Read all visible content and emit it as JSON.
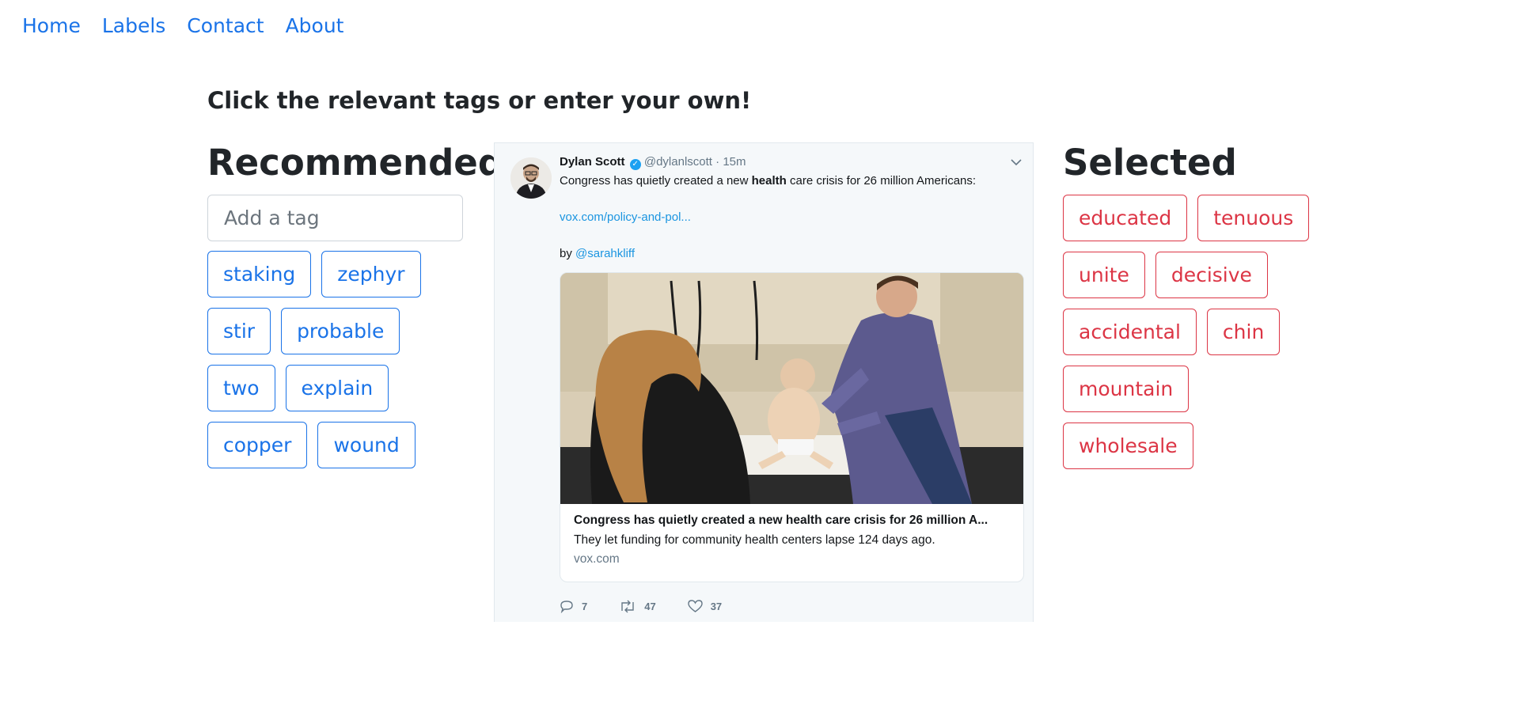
{
  "nav": {
    "items": [
      {
        "label": "Home"
      },
      {
        "label": "Labels"
      },
      {
        "label": "Contact"
      },
      {
        "label": "About"
      }
    ]
  },
  "prompt": "Click the relevant tags or enter your own!",
  "recommended": {
    "title": "Recommended",
    "input_placeholder": "Add a tag",
    "tags": [
      "staking",
      "zephyr",
      "stir",
      "probable",
      "two",
      "explain",
      "copper",
      "wound"
    ]
  },
  "selected": {
    "title": "Selected",
    "tags": [
      "educated",
      "tenuous",
      "unite",
      "decisive",
      "accidental",
      "chin",
      "mountain",
      "wholesale"
    ]
  },
  "tweet": {
    "name": "Dylan Scott",
    "handle": "@dylanlscott",
    "separator": "·",
    "time": "15m",
    "text_before": "Congress has quietly created a new ",
    "text_bold": "health",
    "text_after": " care crisis for 26 million Americans:",
    "link": "vox.com/policy-and-pol...",
    "by_prefix": "by ",
    "by_handle": "@sarahkliff",
    "card": {
      "title": "Congress has quietly created a new health care crisis for 26 million A...",
      "description": "They let funding for community health centers lapse 124 days ago.",
      "domain": "vox.com"
    },
    "replies": "7",
    "retweets": "47",
    "likes": "37",
    "colors": {
      "accent": "#1da1f2",
      "link": "#1b95e0",
      "muted": "#657786"
    }
  },
  "colors": {
    "recommended_tag": "#1a73e8",
    "selected_tag": "#dc3545",
    "nav_link": "#1a73e8"
  }
}
